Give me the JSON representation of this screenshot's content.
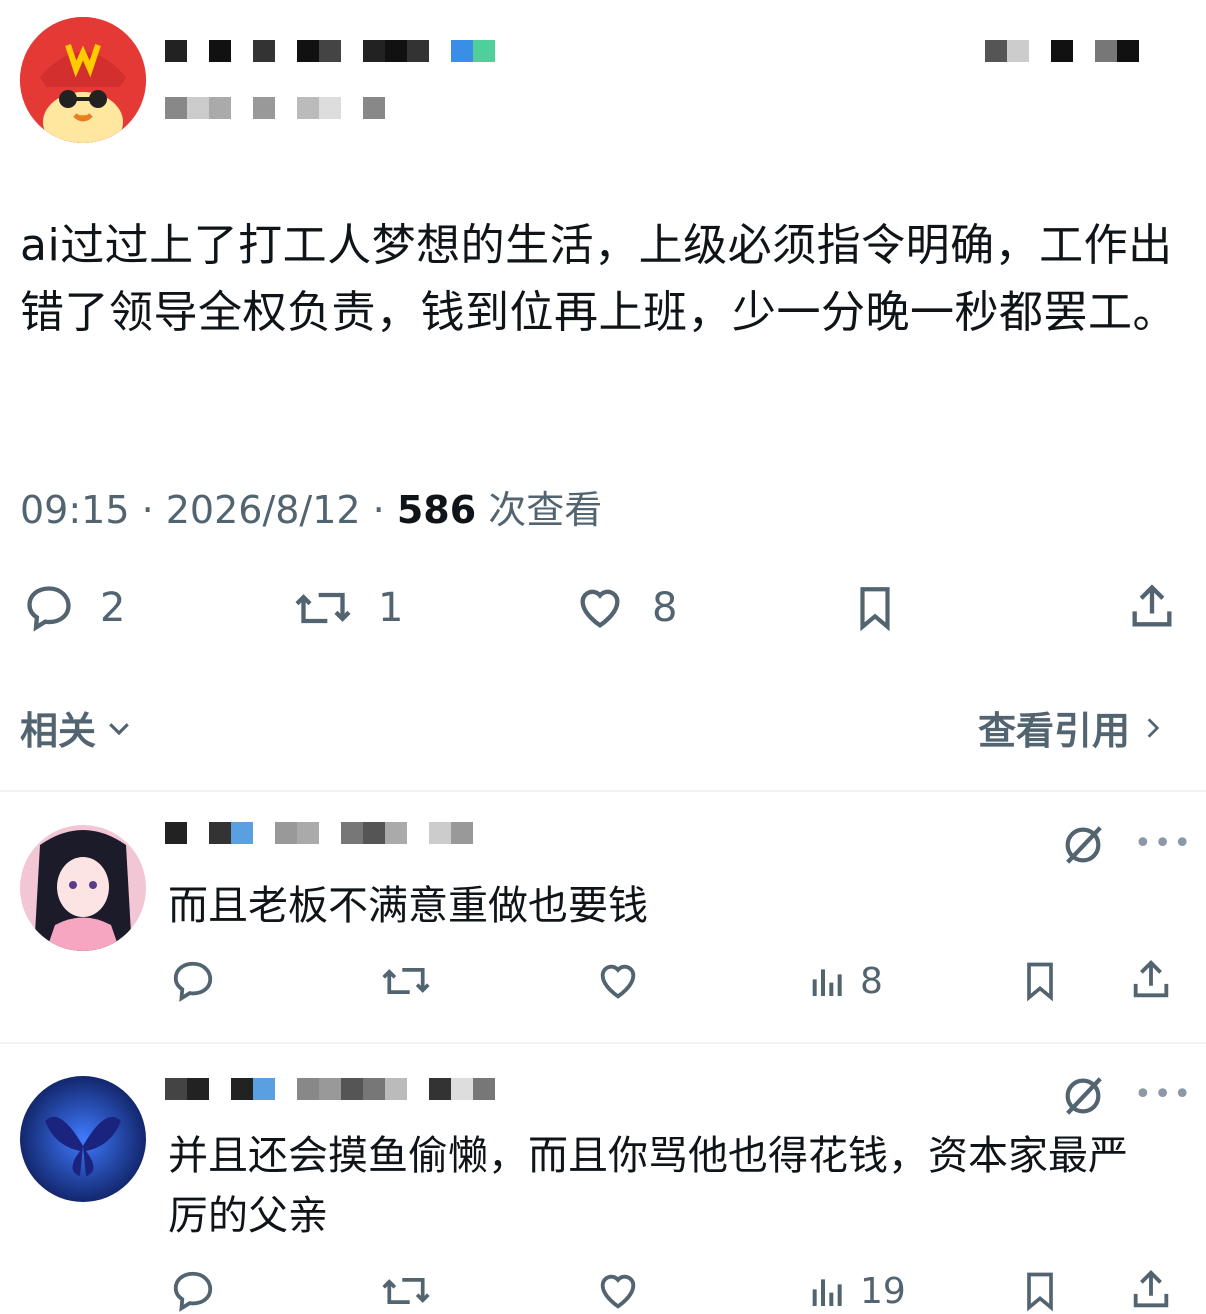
{
  "main_post": {
    "name_pixels": [
      "#222",
      "#fff",
      "#111",
      "#fff",
      "#333",
      "#fff",
      "#111",
      "#444",
      "#fff",
      "#222",
      "#111",
      "#333",
      "#fff",
      "#3a8ee6",
      "#4fd09a"
    ],
    "handle_pixels": [
      "#888",
      "#ccc",
      "#aaa",
      "#fff",
      "#999",
      "#fff",
      "#bbb",
      "#ddd",
      "#fff",
      "#888"
    ],
    "right_pixels": [
      "#555",
      "#ccc",
      "#fff",
      "#111",
      "#fff",
      "#777",
      "#111"
    ],
    "text": "ai过过上了打工人梦想的生活，上级必须指令明确，工作出错了领导全权负责，钱到位再上班，少一分晚一秒都罢工。",
    "time": "09:15 · 2026/8/12 · ",
    "views_count": "586",
    "views_label": " 次查看",
    "reply_count": "2",
    "retweet_count": "1",
    "like_count": "8"
  },
  "related": {
    "label": "相关",
    "quotes_label": "查看引用"
  },
  "replies": [
    {
      "name_pixels": [
        "#222",
        "#fff",
        "#333",
        "#5aa0e0",
        "#fff",
        "#999",
        "#aaa",
        "#fff",
        "#777",
        "#555",
        "#aaa",
        "#fff",
        "#ccc",
        "#999"
      ],
      "text": "而且老板不满意重做也要钱",
      "views": "8"
    },
    {
      "name_pixels": [
        "#444",
        "#222",
        "#fff",
        "#222",
        "#5aa0e0",
        "#fff",
        "#888",
        "#999",
        "#555",
        "#777",
        "#bbb",
        "#fff",
        "#333",
        "#ddd",
        "#777"
      ],
      "text": "并且还会摸鱼偷懒，而且你骂他也得花钱，资本家最严厉的父亲",
      "views": "19"
    }
  ],
  "colors": {
    "text": "#0f1419",
    "muted": "#536471",
    "divider": "#eff3f4"
  }
}
